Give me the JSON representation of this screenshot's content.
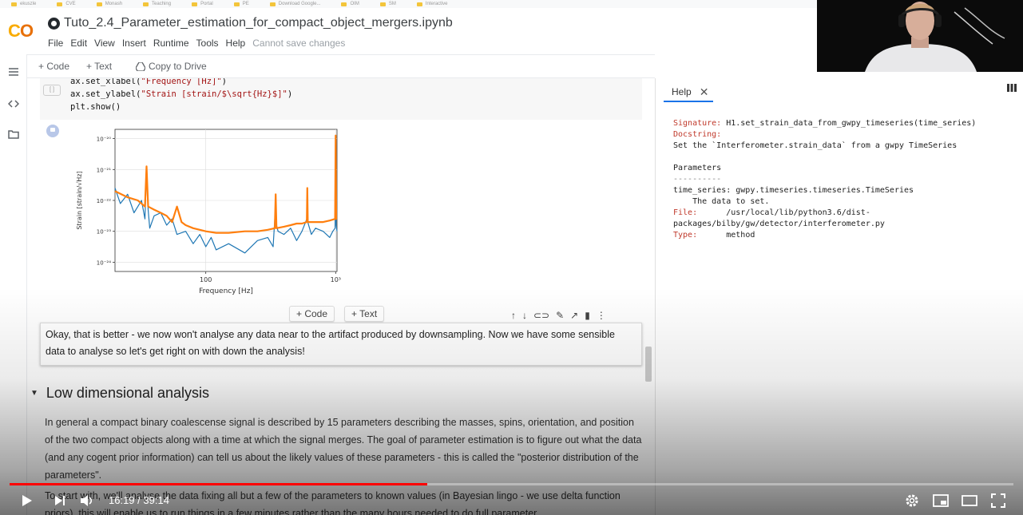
{
  "bookmarks": [
    "ekuszle",
    "CVE",
    "Monash",
    "Teaching",
    "Portal",
    "PE",
    "Download Google...",
    "OIM",
    "SM",
    "Interactive"
  ],
  "notebook": {
    "title": "Tuto_2.4_Parameter_estimation_for_compact_object_mergers.ipynb",
    "menu": [
      "File",
      "Edit",
      "View",
      "Insert",
      "Runtime",
      "Tools",
      "Help"
    ],
    "save_status": "Cannot save changes"
  },
  "toolbar": {
    "code_label": "+ Code",
    "text_label": "+ Text",
    "copy_label": "Copy to Drive"
  },
  "code_cell": {
    "line1_prefix": "ax.set_xlabel(",
    "line1_str": "\"Frequency [Hz]\"",
    "line1_suffix": ")",
    "line2_prefix": "ax.set_ylabel(",
    "line2_str": "\"Strain [strain/$\\sqrt{Hz}$]\"",
    "line2_suffix": ")",
    "line3": "plt.show()"
  },
  "chart_data": {
    "type": "line",
    "xlabel": "Frequency [Hz]",
    "ylabel": "Strain [strain/√Hz]",
    "x_scale": "log",
    "y_scale": "log",
    "xlim": [
      20,
      1024
    ],
    "x_ticks": [
      {
        "value": 100,
        "label": "100"
      },
      {
        "value": 1000,
        "label": "10³"
      }
    ],
    "ylim": [
      -24.3,
      -19.7
    ],
    "y_ticks": [
      {
        "value": -20,
        "label": "10⁻²⁰"
      },
      {
        "value": -21,
        "label": "10⁻²¹"
      },
      {
        "value": -22,
        "label": "10⁻²²"
      },
      {
        "value": -23,
        "label": "10⁻²³"
      },
      {
        "value": -24,
        "label": "10⁻²⁴"
      }
    ],
    "grid": true,
    "series": [
      {
        "color": "#1f77b4",
        "x": [
          20,
          22,
          25,
          28,
          30,
          32,
          34,
          35,
          36,
          37,
          40,
          45,
          50,
          55,
          60,
          70,
          80,
          90,
          100,
          110,
          120,
          150,
          200,
          250,
          300,
          330,
          340,
          360,
          400,
          450,
          500,
          550,
          600,
          650,
          700,
          800,
          900,
          950,
          990,
          1000,
          1010,
          1024
        ],
        "y": [
          -21.6,
          -22.1,
          -21.8,
          -22.4,
          -22.2,
          -22.0,
          -22.6,
          -21.0,
          -22.3,
          -22.9,
          -22.5,
          -22.4,
          -22.8,
          -22.6,
          -23.1,
          -23.0,
          -23.4,
          -23.1,
          -23.5,
          -23.2,
          -23.6,
          -23.4,
          -23.7,
          -23.3,
          -23.2,
          -23.5,
          -22.6,
          -23.0,
          -23.1,
          -22.9,
          -23.3,
          -23.0,
          -22.6,
          -23.1,
          -22.9,
          -23.0,
          -23.2,
          -23.0,
          -22.9,
          -20.0,
          -22.8,
          -23.0
        ]
      },
      {
        "color": "#ff7f0e",
        "x": [
          20,
          25,
          30,
          34,
          35,
          36,
          40,
          45,
          50,
          55,
          60,
          65,
          70,
          80,
          100,
          120,
          150,
          200,
          250,
          300,
          340,
          345,
          350,
          400,
          450,
          500,
          550,
          600,
          605,
          610,
          700,
          800,
          900,
          990,
          1000,
          1010,
          1024
        ],
        "y": [
          -21.7,
          -21.9,
          -22.0,
          -22.2,
          -20.9,
          -22.2,
          -22.3,
          -22.4,
          -22.5,
          -22.7,
          -22.2,
          -22.7,
          -22.8,
          -22.9,
          -23.0,
          -23.05,
          -23.05,
          -23.0,
          -23.0,
          -22.95,
          -22.9,
          -21.8,
          -22.9,
          -22.85,
          -22.8,
          -22.75,
          -22.75,
          -22.7,
          -21.6,
          -22.7,
          -22.7,
          -22.7,
          -22.65,
          -22.6,
          -19.9,
          -22.6,
          -22.6
        ]
      }
    ]
  },
  "add_buttons": {
    "code": "+ Code",
    "text": "+ Text"
  },
  "text_cell": "Okay, that is better - we now won't analyse any data near to the artifact produced by downsampling. Now we have some sensible data to analyse so let's get right on with down the analysis!",
  "section": {
    "title": "Low dimensional analysis",
    "para1": "In general a compact binary coalescense signal is described by 15 parameters describing the masses, spins, orientation, and position of the two compact objects along with a time at which the signal merges. The goal of parameter estimation is to figure out what the data (and any cogent prior information) can tell us about the likely values of these parameters - this is called the \"posterior distribution of the parameters\".",
    "para2": "To start with, we'll analyse the data fixing all but a few of the parameters to known values (in Bayesian lingo - we use delta function priors), this will enable us to run things in a few minutes rather than the many hours needed to do full parameter"
  },
  "help": {
    "tab_label": "Help",
    "signature_key": "Signature:",
    "signature_val": " H1.set_strain_data_from_gwpy_timeseries(time_series)",
    "docstring_key": "Docstring:",
    "docstring_val": "Set the `Interferometer.strain_data` from a gwpy TimeSeries",
    "params_title": "Parameters",
    "params_rule": "----------",
    "param_line": "time_series: gwpy.timeseries.timeseries.TimeSeries",
    "param_desc": "    The data to set.",
    "file_key": "File:",
    "file_val": "      /usr/local/lib/python3.6/dist-",
    "file_val2": "packages/bilby/gw/detector/interferometer.py",
    "type_key": "Type:",
    "type_val": "      method"
  },
  "video": {
    "current_time": "16:19",
    "duration": "39:14",
    "progress": 0.4158
  }
}
